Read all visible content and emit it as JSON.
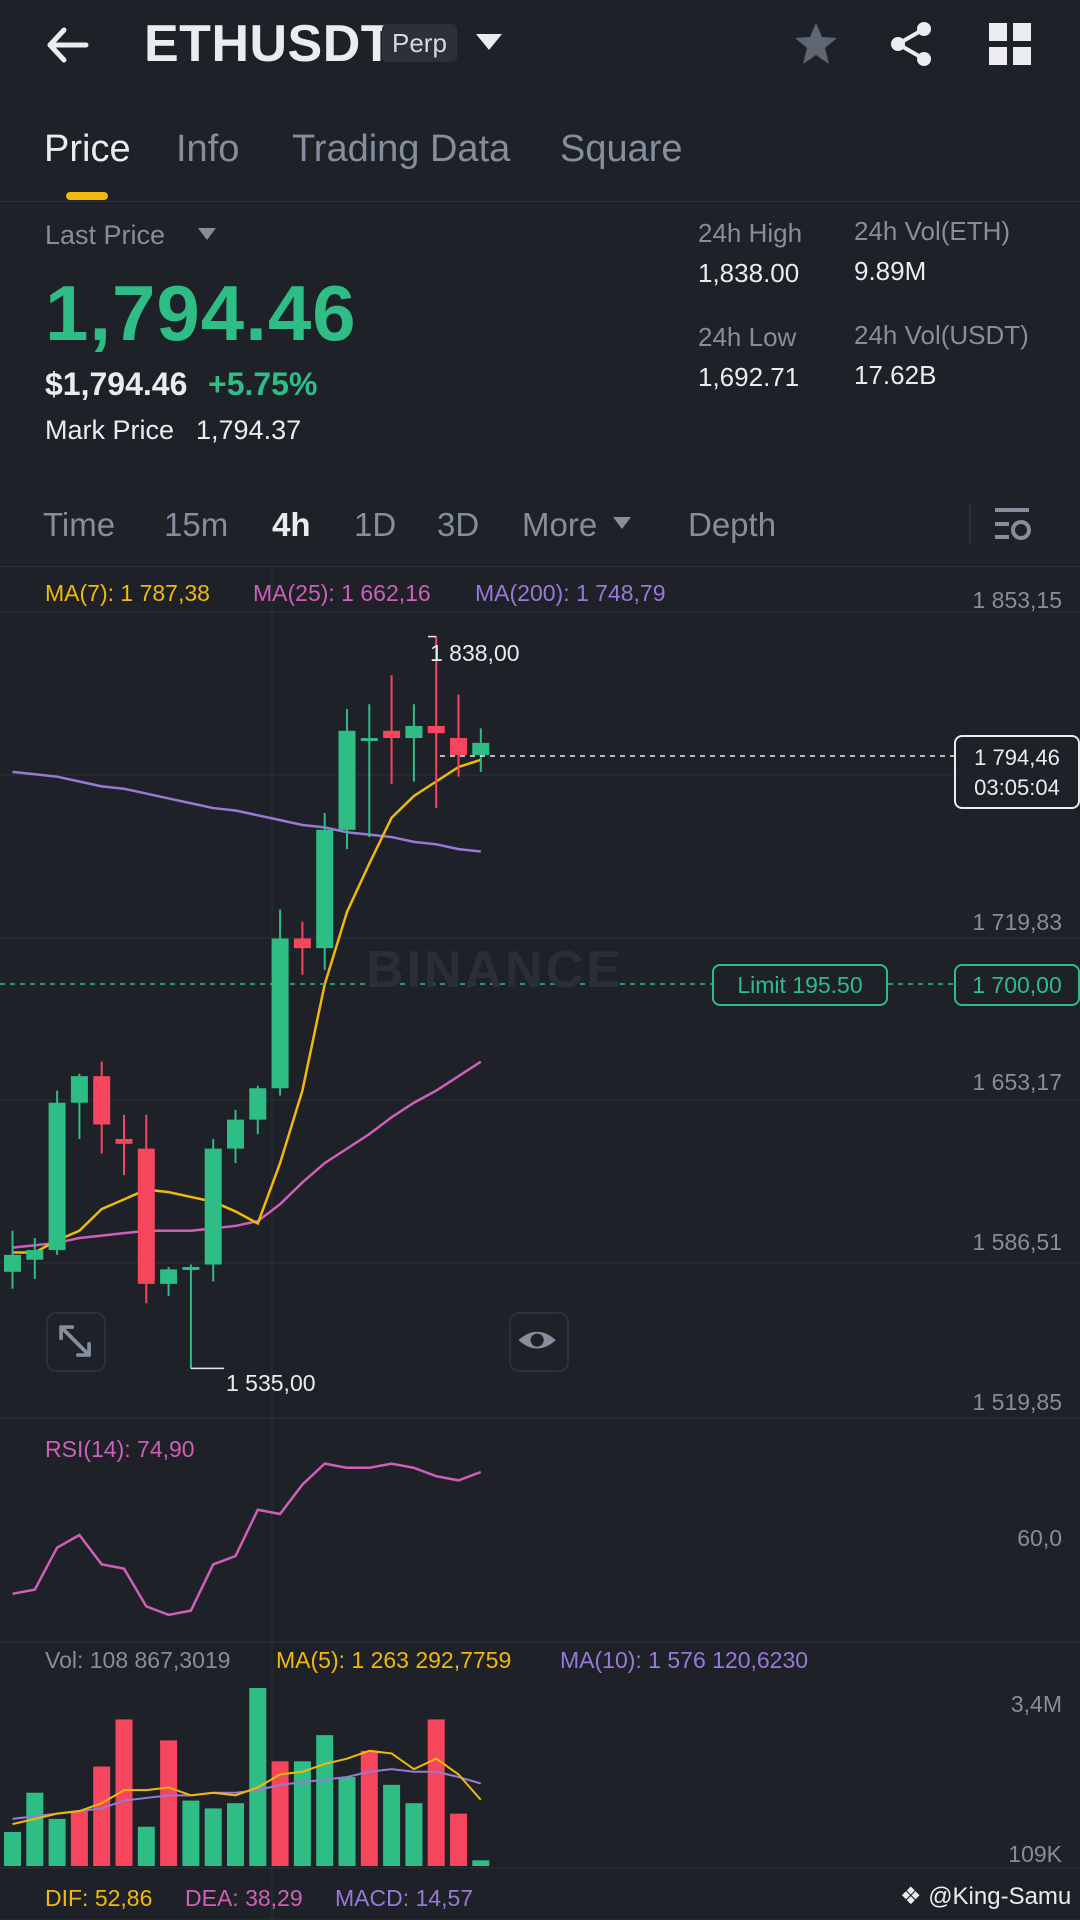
{
  "header": {
    "symbol": "ETHUSDT",
    "badge": "Perp",
    "icons": [
      "back-arrow-icon",
      "dropdown-caret-icon",
      "star-icon",
      "share-icon",
      "grid-menu-icon"
    ]
  },
  "tabs": [
    {
      "label": "Price",
      "active": true
    },
    {
      "label": "Info",
      "active": false
    },
    {
      "label": "Trading Data",
      "active": false
    },
    {
      "label": "Square",
      "active": false
    }
  ],
  "price": {
    "label": "Last Price",
    "last": "1,794.46",
    "usd": "$1,794.46",
    "change": "+5.75%",
    "mark_label": "Mark Price",
    "mark_value": "1,794.37"
  },
  "stats": {
    "high_label": "24h High",
    "high": "1,838.00",
    "low_label": "24h Low",
    "low": "1,692.71",
    "vol_eth_label": "24h Vol(ETH)",
    "vol_eth": "9.89M",
    "vol_usdt_label": "24h Vol(USDT)",
    "vol_usdt": "17.62B"
  },
  "intervals": [
    {
      "label": "Time",
      "active": false
    },
    {
      "label": "15m",
      "active": false
    },
    {
      "label": "4h",
      "active": true
    },
    {
      "label": "1D",
      "active": false
    },
    {
      "label": "3D",
      "active": false
    },
    {
      "label": "More",
      "active": false
    },
    {
      "label": "Depth",
      "active": false
    }
  ],
  "ma": {
    "ma7": "MA(7): 1 787,38",
    "ma25": "MA(25): 1 662,16",
    "ma200": "MA(200): 1 748,79"
  },
  "chart": {
    "current_price": "1 794,46",
    "countdown": "03:05:04",
    "high_marker": "1 838,00",
    "low_marker": "1 535,00",
    "limit_label": "Limit  195.50",
    "limit_price": "1 700,00",
    "watermark": "BINANCE"
  },
  "chart_data": {
    "type": "candlestick",
    "interval": "4h",
    "ylim": [
      1519.85,
      1853.15
    ],
    "y_ticks": [
      "1 853,15",
      "1 719,83",
      "1 653,17",
      "1 586,51",
      "1 519,85"
    ],
    "candles": [
      {
        "o": 1575,
        "h": 1592,
        "l": 1568,
        "c": 1582
      },
      {
        "o": 1580,
        "h": 1589,
        "l": 1572,
        "c": 1584
      },
      {
        "o": 1584,
        "h": 1650,
        "l": 1582,
        "c": 1645
      },
      {
        "o": 1645,
        "h": 1657,
        "l": 1630,
        "c": 1656
      },
      {
        "o": 1656,
        "h": 1662,
        "l": 1624,
        "c": 1636
      },
      {
        "o": 1630,
        "h": 1640,
        "l": 1615,
        "c": 1628
      },
      {
        "o": 1626,
        "h": 1640,
        "l": 1562,
        "c": 1570
      },
      {
        "o": 1570,
        "h": 1577,
        "l": 1565,
        "c": 1576
      },
      {
        "o": 1576,
        "h": 1578,
        "l": 1535,
        "c": 1577
      },
      {
        "o": 1578,
        "h": 1630,
        "l": 1571,
        "c": 1626
      },
      {
        "o": 1626,
        "h": 1642,
        "l": 1620,
        "c": 1638
      },
      {
        "o": 1638,
        "h": 1652,
        "l": 1632,
        "c": 1651
      },
      {
        "o": 1651,
        "h": 1725,
        "l": 1648,
        "c": 1713
      },
      {
        "o": 1713,
        "h": 1720,
        "l": 1698,
        "c": 1709
      },
      {
        "o": 1709,
        "h": 1765,
        "l": 1700,
        "c": 1758
      },
      {
        "o": 1758,
        "h": 1808,
        "l": 1750,
        "c": 1799
      },
      {
        "o": 1796,
        "h": 1810,
        "l": 1755,
        "c": 1796
      },
      {
        "o": 1799,
        "h": 1822,
        "l": 1777,
        "c": 1796
      },
      {
        "o": 1796,
        "h": 1810,
        "l": 1778,
        "c": 1801
      },
      {
        "o": 1801,
        "h": 1838,
        "l": 1767,
        "c": 1798
      },
      {
        "o": 1796,
        "h": 1814,
        "l": 1780,
        "c": 1789
      },
      {
        "o": 1789,
        "h": 1800,
        "l": 1782,
        "c": 1794
      }
    ],
    "ma7": [
      1583,
      1583,
      1588,
      1592,
      1601,
      1605,
      1609,
      1608,
      1606,
      1604,
      1600,
      1595,
      1620,
      1650,
      1694,
      1724,
      1744,
      1763,
      1772,
      1778,
      1784,
      1787
    ],
    "ma25": [
      1585,
      1586,
      1587,
      1589,
      1590,
      1591,
      1592,
      1592,
      1592,
      1593,
      1594,
      1596,
      1603,
      1612,
      1620,
      1626,
      1632,
      1639,
      1645,
      1650,
      1656,
      1662
    ],
    "ma200": [
      1782,
      1781,
      1780,
      1778,
      1776,
      1775,
      1773,
      1771,
      1769,
      1767,
      1766,
      1764,
      1762,
      1760,
      1759,
      1757,
      1756,
      1755,
      1753,
      1752,
      1750,
      1749
    ],
    "rsi": {
      "label": "RSI(14): 74,90",
      "tick": "60,0",
      "values": [
        46,
        47,
        57,
        60,
        53,
        52,
        43,
        41,
        42,
        53,
        55,
        66,
        65,
        72,
        77,
        76,
        76,
        77,
        76,
        74,
        73,
        75
      ]
    },
    "volume": {
      "label": "Vol: 108 867,3019",
      "ma5_label": "MA(5): 1 263 292,7759",
      "ma10_label": "MA(10): 1 576 120,6230",
      "ticks": [
        "3,4M",
        "109K"
      ],
      "bars": [
        {
          "v": 650,
          "up": true
        },
        {
          "v": 1400,
          "up": true
        },
        {
          "v": 900,
          "up": true
        },
        {
          "v": 1050,
          "up": false
        },
        {
          "v": 1900,
          "up": false
        },
        {
          "v": 2800,
          "up": false
        },
        {
          "v": 750,
          "up": true
        },
        {
          "v": 2400,
          "up": false
        },
        {
          "v": 1250,
          "up": true
        },
        {
          "v": 1100,
          "up": true
        },
        {
          "v": 1200,
          "up": true
        },
        {
          "v": 3400,
          "up": true
        },
        {
          "v": 2000,
          "up": false
        },
        {
          "v": 2000,
          "up": true
        },
        {
          "v": 2500,
          "up": true
        },
        {
          "v": 1700,
          "up": true
        },
        {
          "v": 2200,
          "up": false
        },
        {
          "v": 1550,
          "up": true
        },
        {
          "v": 1200,
          "up": true
        },
        {
          "v": 2800,
          "up": false
        },
        {
          "v": 1000,
          "up": false
        },
        {
          "v": 109,
          "up": true
        }
      ],
      "ma5": [
        800,
        900,
        1000,
        1050,
        1200,
        1450,
        1450,
        1500,
        1350,
        1400,
        1350,
        1500,
        1750,
        1800,
        1950,
        2050,
        2200,
        2150,
        1850,
        2050,
        1750,
        1263
      ],
      "ma10": [
        900,
        950,
        1000,
        1050,
        1100,
        1250,
        1300,
        1350,
        1350,
        1400,
        1400,
        1450,
        1550,
        1600,
        1650,
        1700,
        1800,
        1850,
        1800,
        1800,
        1700,
        1576
      ]
    },
    "macd": {
      "dif": "DIF: 52,86",
      "dea": "DEA: 38,29",
      "macd": "MACD: 14,57"
    }
  },
  "footer": {
    "credit": "@King-Samu"
  },
  "colors": {
    "up": "#2ebd85",
    "down": "#f6465d",
    "ma7": "#f0b90b",
    "ma25": "#d05fb9",
    "ma200": "#9979d6",
    "accent": "#f0b90b",
    "bg": "#1e2128"
  }
}
